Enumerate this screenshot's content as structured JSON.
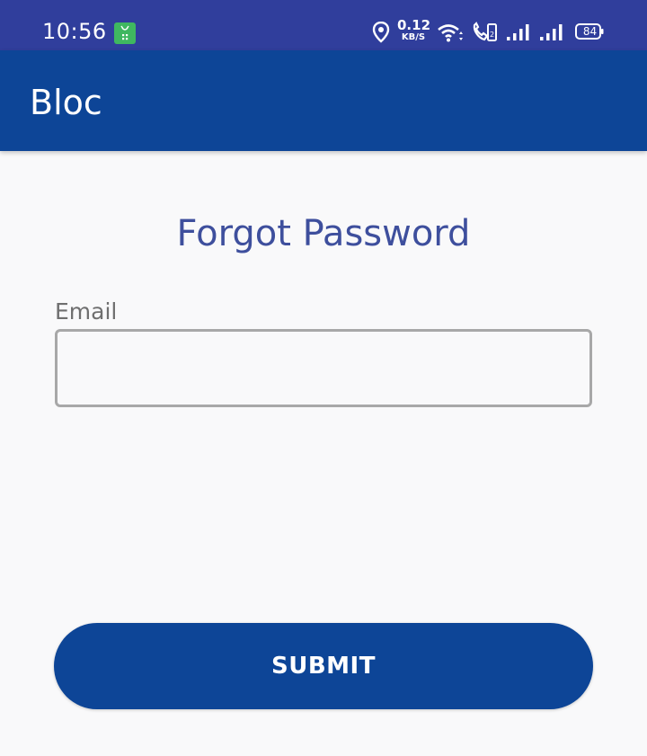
{
  "status_bar": {
    "time": "10:56",
    "net_speed_value": "0.12",
    "net_speed_unit": "KB/S",
    "battery_level": "84",
    "background_color": "#303e9c",
    "icons": [
      "notification-app-icon",
      "location-icon",
      "wifi-icon",
      "call-volte-icon",
      "signal-icon",
      "signal-icon",
      "battery-icon"
    ]
  },
  "app_bar": {
    "title": "Bloc",
    "background_color": "#0d4597"
  },
  "form": {
    "title": "Forgot Password",
    "email_label": "Email",
    "email_value": "",
    "submit_label": "SUBMIT",
    "title_color": "#3e4f9d",
    "button_color": "#0d4597"
  }
}
